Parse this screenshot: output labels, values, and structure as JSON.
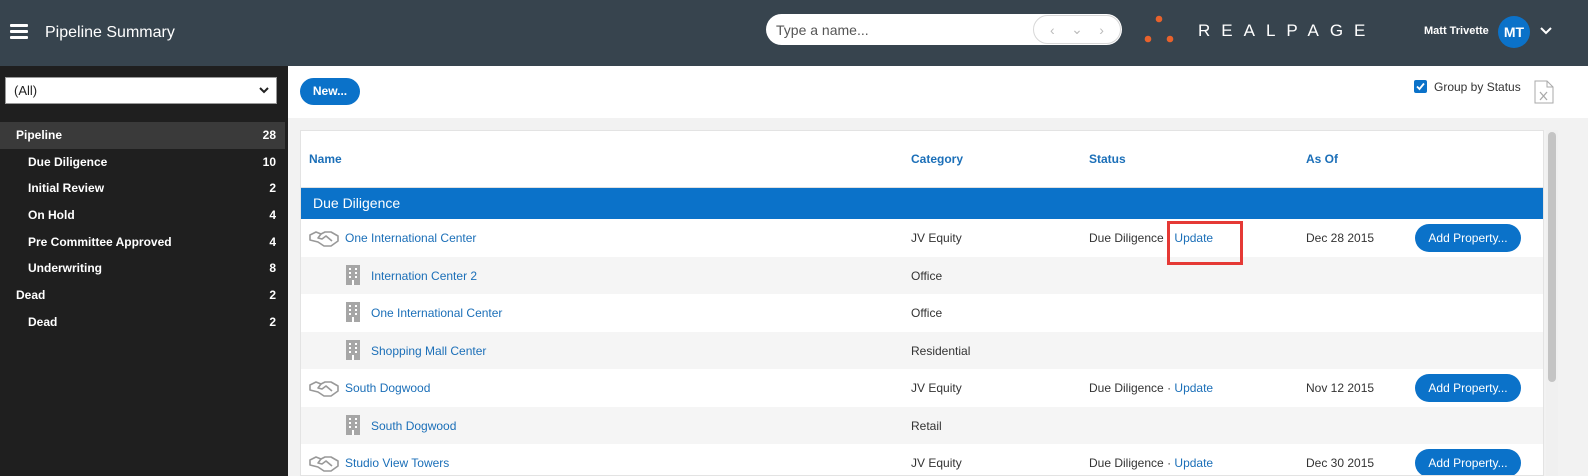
{
  "header": {
    "title": "Pipeline Summary",
    "search_placeholder": "Type a name...",
    "logo_text": "REALPAGE",
    "user_name": "Matt Trivette",
    "user_initials": "MT",
    "colors": {
      "header_bg": "#37444e",
      "accent": "#0b72c9",
      "logo_dots": "#e8622c"
    }
  },
  "sidebar": {
    "filter_value": "(All)",
    "items": [
      {
        "label": "Pipeline",
        "count": "28",
        "level": 0
      },
      {
        "label": "Due Diligence",
        "count": "10",
        "level": 1
      },
      {
        "label": "Initial Review",
        "count": "2",
        "level": 1
      },
      {
        "label": "On Hold",
        "count": "4",
        "level": 1
      },
      {
        "label": "Pre Committee Approved",
        "count": "4",
        "level": 1
      },
      {
        "label": "Underwriting",
        "count": "8",
        "level": 1
      },
      {
        "label": "Dead",
        "count": "2",
        "level": 0
      },
      {
        "label": "Dead",
        "count": "2",
        "level": 1
      }
    ]
  },
  "toolbar": {
    "new_label": "New...",
    "group_by_label": "Group by Status",
    "group_by_checked": true
  },
  "grid": {
    "columns": {
      "name": "Name",
      "category": "Category",
      "status": "Status",
      "as_of": "As Of"
    },
    "group_title": "Due Diligence",
    "rows": [
      {
        "type": "deal",
        "name": "One International Center",
        "category": "JV Equity",
        "status": "Due Diligence",
        "status_sep": "·",
        "update": "Update",
        "as_of": "Dec 28 2015",
        "action": "Add Property..."
      },
      {
        "type": "property",
        "name": "Internation Center 2",
        "category": "Office"
      },
      {
        "type": "property",
        "name": "One International Center",
        "category": "Office"
      },
      {
        "type": "property",
        "name": "Shopping Mall Center",
        "category": "Residential"
      },
      {
        "type": "deal",
        "name": "South Dogwood",
        "category": "JV Equity",
        "status": "Due Diligence",
        "status_sep": "·",
        "update": "Update",
        "as_of": "Nov 12 2015",
        "action": "Add Property..."
      },
      {
        "type": "property",
        "name": "South Dogwood",
        "category": "Retail"
      },
      {
        "type": "deal",
        "name": "Studio View Towers",
        "category": "JV Equity",
        "status": "Due Diligence",
        "status_sep": "·",
        "update": "Update",
        "as_of": "Dec 30 2015",
        "action": "Add Property..."
      }
    ]
  }
}
